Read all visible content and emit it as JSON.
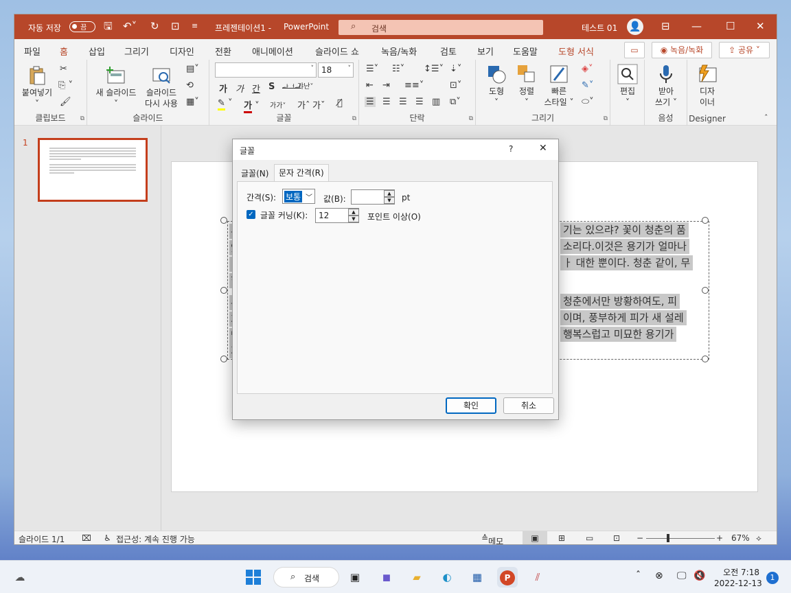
{
  "titlebar": {
    "autosave_label": "자동 저장",
    "autosave_state": "끔",
    "doc_title": "프레젠테이션1 -",
    "app_name": "PowerPoint",
    "search_placeholder": "검색",
    "user_name": "테스트 01"
  },
  "tabs": [
    "파일",
    "홈",
    "삽입",
    "그리기",
    "디자인",
    "전환",
    "애니메이션",
    "슬라이드 쇼",
    "녹음/녹화",
    "검토",
    "보기",
    "도움말",
    "도형 서식"
  ],
  "tab_buttons": {
    "record": "녹음/녹화",
    "share": "공유"
  },
  "ribbon": {
    "clipboard": {
      "paste": "붙여넣기",
      "label": "클립보드"
    },
    "slides": {
      "new_slide": "새 슬라이드",
      "reuse1": "슬라이드",
      "reuse2": "다시 사용",
      "label": "슬라이드"
    },
    "font": {
      "font_name": "",
      "font_size": "18",
      "label": "글꼴"
    },
    "paragraph": {
      "label": "단락"
    },
    "drawing": {
      "shape": "도형",
      "arrange": "정렬",
      "quick1": "빠른",
      "quick2": "스타일",
      "label": "그리기"
    },
    "editing": {
      "edit": "편집"
    },
    "voice": {
      "dictate1": "받아",
      "dictate2": "쓰기",
      "label": "음성"
    },
    "designer": {
      "d1": "디자",
      "d2": "이너",
      "label": "Designer"
    }
  },
  "slide_pane": {
    "number": "1"
  },
  "slide_text": {
    "lines_right": [
      "기는 있으랴? 꽃이 청춘의 품",
      "소리다.이것은 용기가 얼마나",
      "ㅏ 대한 뿐이다. 청춘 같이, 무",
      "청춘에서만 방황하여도, 피",
      "이며, 풍부하게 피가 새 설레",
      "행복스럽고 미묘한 용기가"
    ],
    "lines_left": [
      "무",
      "있",
      "ㅎ",
      "힘",
      "무",
      "가",
      "많",
      "가"
    ]
  },
  "dialog": {
    "title": "글꼴",
    "help": "?",
    "tabs": [
      "글꼴(N)",
      "문자 간격(R)"
    ],
    "spacing_label": "간격(S):",
    "spacing_value": "보통",
    "by_label": "값(B):",
    "by_value": "",
    "unit": "pt",
    "kerning_label": "글꼴 커닝(K):",
    "kerning_value": "12",
    "kerning_suffix": "포인트 이상(O)",
    "ok": "확인",
    "cancel": "취소"
  },
  "status": {
    "slide_count": "슬라이드 1/1",
    "accessibility": "접근성: 계속 진행 가능",
    "notes": "메모",
    "zoom": "67%"
  },
  "taskbar": {
    "search": "검색",
    "time": "오전 7:18",
    "date": "2022-12-13",
    "notification_count": "1"
  },
  "colors": {
    "accent": "#b7472a",
    "win_blue": "#0067c0"
  }
}
